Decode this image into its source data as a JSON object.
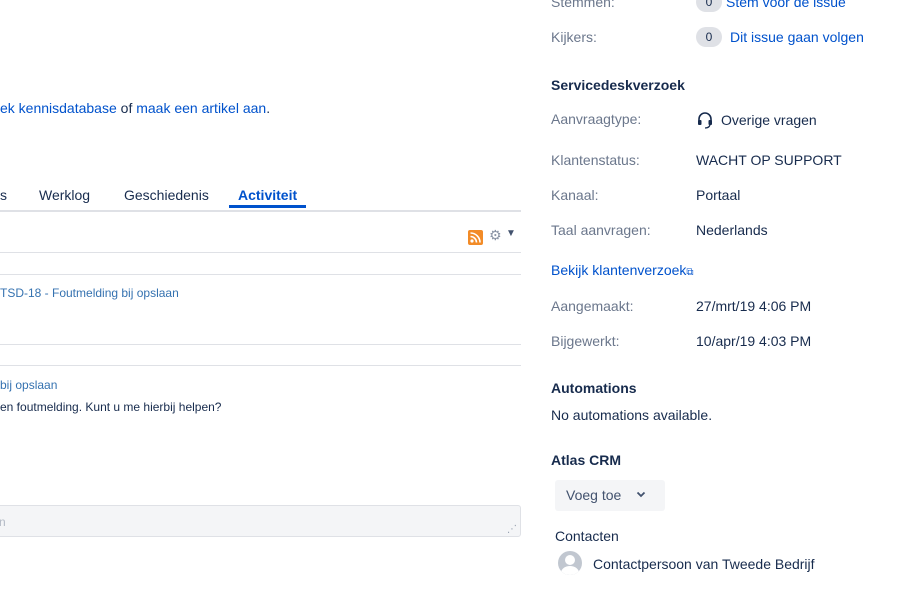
{
  "left": {
    "kb_line": {
      "prefix_link": "ek kennisdatabase",
      "middle": " of ",
      "create_link": "maak een artikel aan",
      "suffix": "."
    },
    "tabs": [
      {
        "label": "s"
      },
      {
        "label": "Werklog"
      },
      {
        "label": "Geschiedenis"
      },
      {
        "label": "Activiteit",
        "active": true
      }
    ],
    "toolbar": {
      "rss_icon": "rss-icon",
      "settings_icon": "gear-icon"
    },
    "activity": [
      {
        "title": "TSD-18 - Foutmelding bij opslaan"
      },
      {
        "title": "bij opslaan",
        "body": "en foutmelding. Kunt u me hierbij helpen?"
      }
    ],
    "comment": {
      "placeholder": "n"
    }
  },
  "right": {
    "votes": {
      "label": "Stemmen:",
      "count": "0",
      "link": "Stem voor de issue"
    },
    "watchers": {
      "label": "Kijkers:",
      "count": "0",
      "link": "Dit issue gaan volgen"
    },
    "servicedesk": {
      "heading": "Servicedeskverzoek",
      "request_type": {
        "label": "Aanvraagtype:",
        "value": "Overige vragen",
        "icon": "headset-icon"
      },
      "customer_status": {
        "label": "Klantenstatus:",
        "value": "WACHT OP SUPPORT"
      },
      "channel": {
        "label": "Kanaal:",
        "value": "Portaal"
      },
      "language": {
        "label": "Taal aanvragen:",
        "value": "Nederlands"
      },
      "view_link": "Bekijk klantenverzoek"
    },
    "dates": {
      "created": {
        "label": "Aangemaakt:",
        "value": "27/mrt/19 4:06 PM"
      },
      "updated": {
        "label": "Bijgewerkt:",
        "value": "10/apr/19 4:03 PM"
      }
    },
    "automations": {
      "heading": "Automations",
      "text": "No automations available."
    },
    "crm": {
      "heading": "Atlas CRM",
      "add_button": "Voeg toe",
      "contacts_label": "Contacten",
      "contacts": [
        {
          "name": "Contactpersoon van Tweede Bedrijf"
        }
      ]
    }
  },
  "colors": {
    "link": "#0052cc",
    "label": "#6b778c",
    "text": "#172b4d",
    "badge": "#dfe1e6",
    "rss": "#f28b27"
  }
}
